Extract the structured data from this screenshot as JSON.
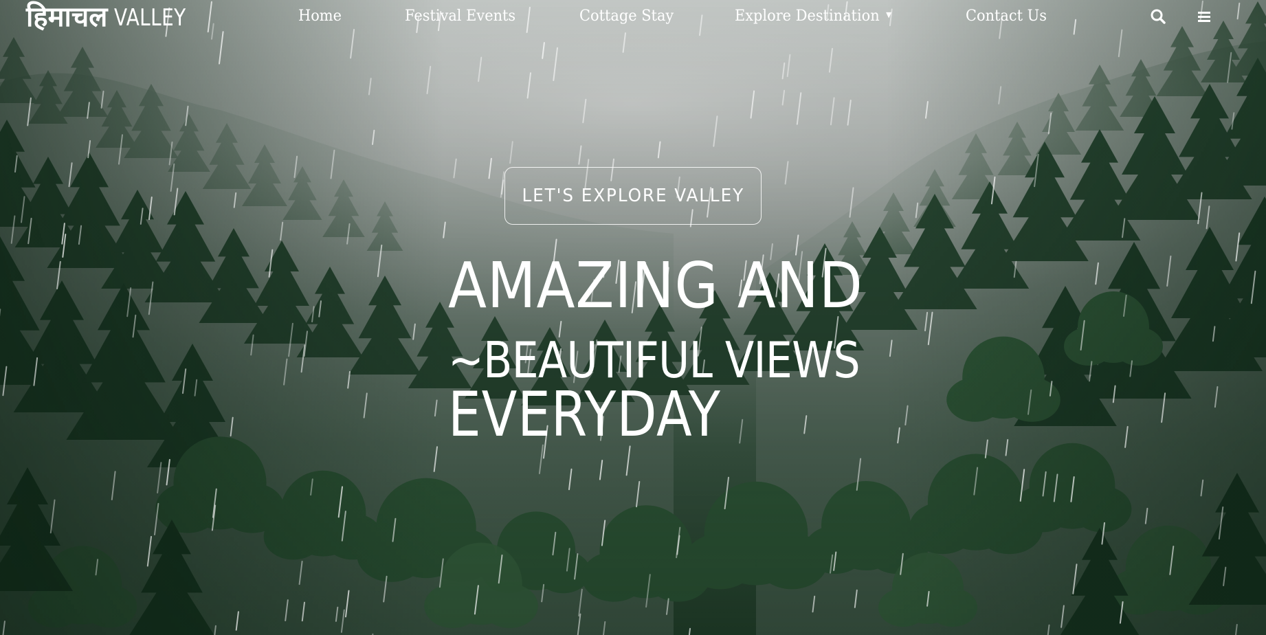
{
  "site": {
    "logo_hindi": "हिमाचल",
    "logo_latin": "VALLEY"
  },
  "nav": {
    "items": [
      {
        "label": "Home"
      },
      {
        "label": "Festival Events"
      },
      {
        "label": "Cottage Stay"
      },
      {
        "label": "Explore Destination",
        "has_dropdown": true
      },
      {
        "label": "Contact Us"
      }
    ],
    "icons": [
      "search-icon",
      "menu-icon"
    ]
  },
  "hero": {
    "tagline": "LET'S EXPLORE VALLEY",
    "headline_line1": "AMAZING AND",
    "headline_line2": "~BEAUTIFUL VIEWS",
    "headline_line3": "EVERYDAY"
  },
  "colors": {
    "text": "#ffffff",
    "fog": "#c9ccca",
    "forest_dark": "#173522",
    "forest_mid": "#2f5a3b"
  }
}
